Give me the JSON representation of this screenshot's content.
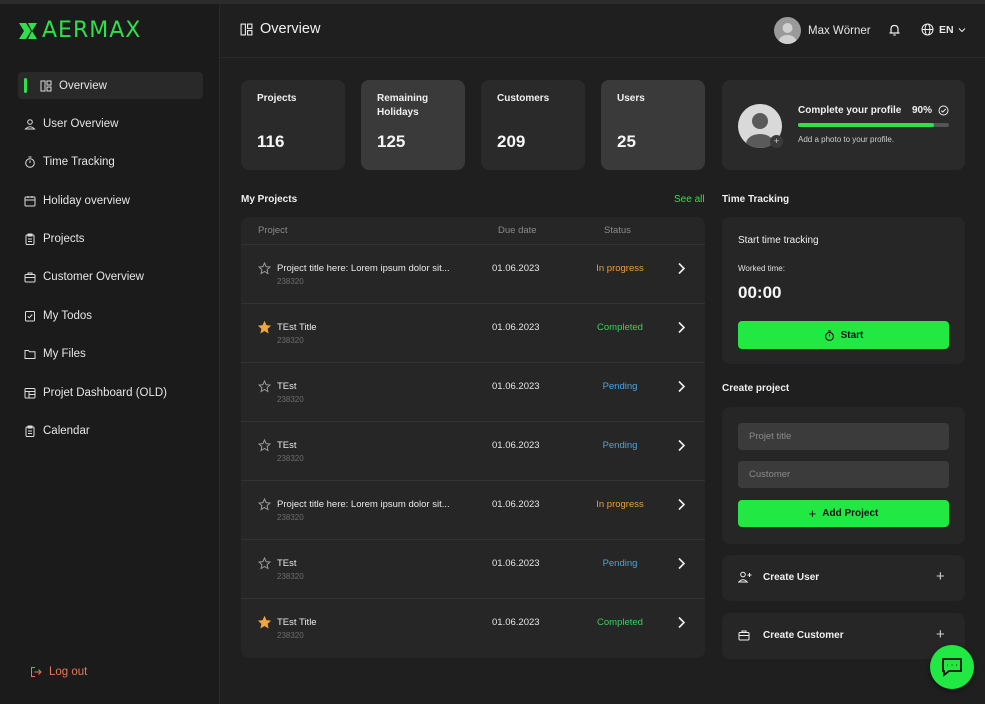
{
  "brand": {
    "name": "AERMAX",
    "accent": "#2ee04b"
  },
  "sidebar": {
    "items": [
      {
        "label": "Overview",
        "icon": "dashboard-icon",
        "active": true
      },
      {
        "label": "User Overview",
        "icon": "user-icon"
      },
      {
        "label": "Time Tracking",
        "icon": "stopwatch-icon"
      },
      {
        "label": "Holiday overview",
        "icon": "calendar-icon"
      },
      {
        "label": "Projects",
        "icon": "clipboard-icon"
      },
      {
        "label": "Customer Overview",
        "icon": "briefcase-icon"
      },
      {
        "label": "My Todos",
        "icon": "checklist-icon"
      },
      {
        "label": "My Files",
        "icon": "folder-icon"
      },
      {
        "label": "Projet Dashboard (OLD)",
        "icon": "layout-icon"
      },
      {
        "label": "Calendar",
        "icon": "clipboard-icon"
      }
    ],
    "logout": "Log out"
  },
  "header": {
    "title": "Overview",
    "user_name": "Max Wörner",
    "language": "EN"
  },
  "stats": [
    {
      "label": "Projects",
      "value": "116"
    },
    {
      "label": "Remaining Holidays",
      "value": "125"
    },
    {
      "label": "Customers",
      "value": "209"
    },
    {
      "label": "Users",
      "value": "25"
    }
  ],
  "profile": {
    "title": "Complete your profile",
    "percent_label": "90%",
    "progress": 0.9,
    "subtitle": "Add a photo to your profile."
  },
  "projects": {
    "title": "My Projects",
    "see_all": "See all",
    "columns": [
      "Project",
      "Due date",
      "Status"
    ],
    "rows": [
      {
        "title": "Project title here: Lorem ipsum dolor sit...",
        "id": "238320",
        "date": "01.06.2023",
        "status": "In progress",
        "starred": false
      },
      {
        "title": "TEst Title",
        "id": "238320",
        "date": "01.06.2023",
        "status": "Completed",
        "starred": true
      },
      {
        "title": "TEst",
        "id": "238320",
        "date": "01.06.2023",
        "status": "Pending",
        "starred": false
      },
      {
        "title": "TEst",
        "id": "238320",
        "date": "01.06.2023",
        "status": "Pending",
        "starred": false
      },
      {
        "title": "Project title here: Lorem ipsum dolor sit...",
        "id": "238320",
        "date": "01.06.2023",
        "status": "In progress",
        "starred": false
      },
      {
        "title": "TEst",
        "id": "238320",
        "date": "01.06.2023",
        "status": "Pending",
        "starred": false
      },
      {
        "title": "TEst Title",
        "id": "238320",
        "date": "01.06.2023",
        "status": "Completed",
        "starred": true
      }
    ]
  },
  "status_colors": {
    "In progress": "#e6a33a",
    "Completed": "#3ecf5c",
    "Pending": "#4aa3df"
  },
  "time_tracking": {
    "title": "Time Tracking",
    "start_label": "Start time tracking",
    "worked_label": "Worked time:",
    "time": "00:00",
    "button": "Start"
  },
  "create_project": {
    "title": "Create project",
    "title_placeholder": "Projet title",
    "customer_placeholder": "Customer",
    "button": "Add Project"
  },
  "actions": [
    {
      "label": "Create User",
      "icon": "add-user-icon"
    },
    {
      "label": "Create Customer",
      "icon": "briefcase-icon"
    }
  ]
}
